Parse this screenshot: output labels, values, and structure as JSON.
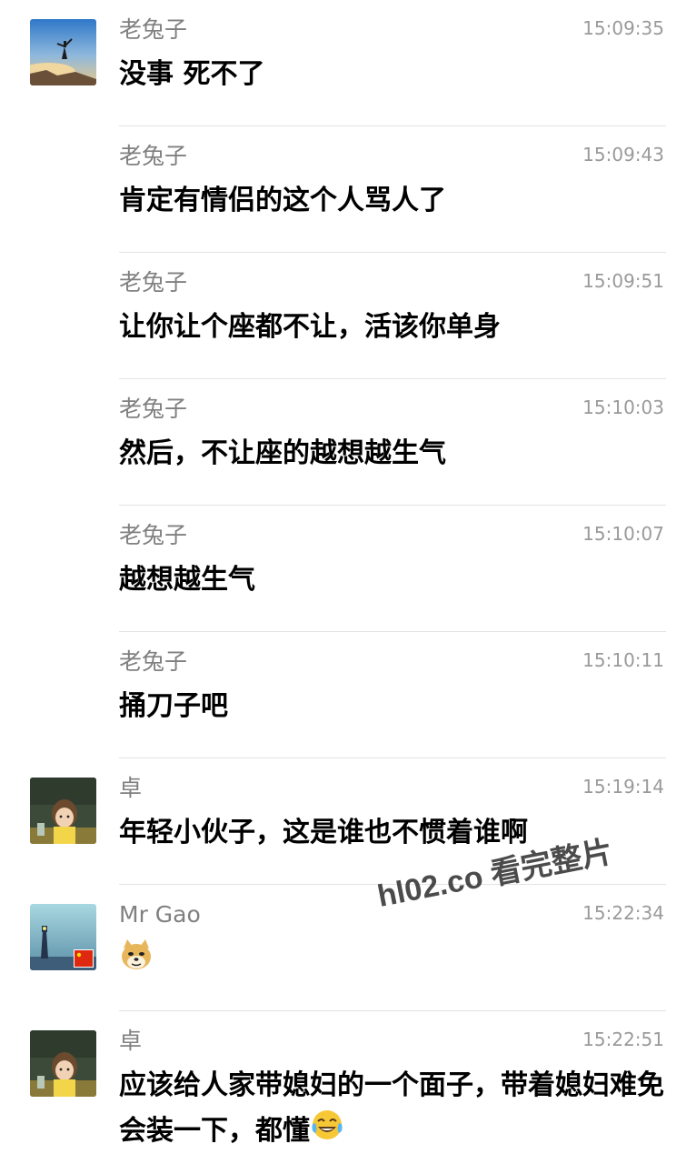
{
  "messages": [
    {
      "sender": "老兔子",
      "time": "15:09:35",
      "text": "没事 死不了",
      "avatar": "mountain-avatar-icon"
    },
    {
      "sender": "老兔子",
      "time": "15:09:43",
      "text": "肯定有情侣的这个人骂人了"
    },
    {
      "sender": "老兔子",
      "time": "15:09:51",
      "text": "让你让个座都不让，活该你单身"
    },
    {
      "sender": "老兔子",
      "time": "15:10:03",
      "text": "然后，不让座的越想越生气"
    },
    {
      "sender": "老兔子",
      "time": "15:10:07",
      "text": "越想越生气"
    },
    {
      "sender": "老兔子",
      "time": "15:10:11",
      "text": "捅刀子吧"
    },
    {
      "sender": "卓",
      "time": "15:19:14",
      "text": "年轻小伙子，这是谁也不惯着谁啊",
      "avatar": "anime-girl-avatar-icon"
    },
    {
      "sender": "Mr Gao",
      "time": "15:22:34",
      "text": "",
      "avatar": "lighthouse-avatar-icon",
      "emoji": "doge-emoji-icon"
    },
    {
      "sender": "卓",
      "time": "15:22:51",
      "text": "应该给人家带媳妇的一个面子，带着媳妇难免会装一下，都懂",
      "avatar": "anime-girl-avatar-icon",
      "emoji": "tears-of-joy-emoji-icon"
    }
  ],
  "watermark": "hl02.co 看完整片"
}
